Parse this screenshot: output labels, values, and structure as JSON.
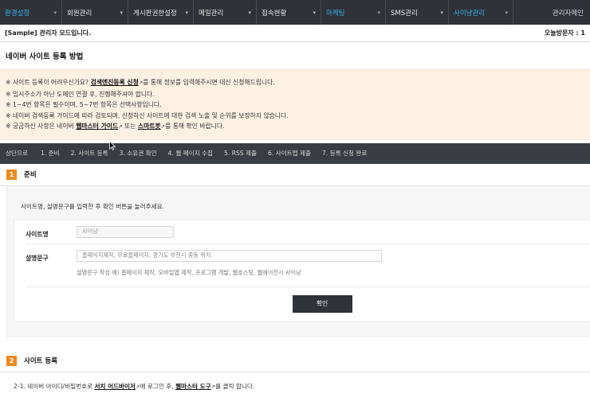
{
  "nav": {
    "items": [
      {
        "label": "환경설정",
        "active": true
      },
      {
        "label": "회원관리",
        "active": false
      },
      {
        "label": "게시판권한설정",
        "active": false
      },
      {
        "label": "메일관리",
        "active": false
      },
      {
        "label": "접속현황",
        "active": false
      },
      {
        "label": "마케팅",
        "active": true
      },
      {
        "label": "SMS관리",
        "active": false
      },
      {
        "label": "사이냥관리",
        "active": true
      }
    ],
    "admin_main": "관리자메인"
  },
  "status": {
    "mode": "[Sample] 관리자 모드입니다.",
    "visitors": "오늘방문자 : 1"
  },
  "page_title": "네이버 사이트 등록 방법",
  "notice": {
    "l1_a": "※ 사이트 등록이 어려우신가요? ",
    "l1_link": "검색엔진등록 신청",
    "l1_b": "를 통해 정보를 입력해주시면 대신 신청해드립니다.",
    "l2": "※ 임시주소가 아닌 도메인 연결 후, 진행해주셔야 합니다.",
    "l3": "※ 1~4번 항목은 필수이며, 5~7번 항목은 선택사항입니다.",
    "l4": "※ 네이버 검색등록 가이드에 따라 검토되며, 신청하신 사이트에 대한 검색 노출 및 순위를 보장하지 않습니다.",
    "l5_a": "※ 궁금하신 사항은 네이버 ",
    "l5_link1": "웹마스터 가이드",
    "l5_b": " 또는 ",
    "l5_link2": "스마트봇",
    "l5_c": "를 통해 확인 바랍니다.",
    "ext_glyph": "↗"
  },
  "steps": [
    "상단으로",
    "1. 준비",
    "2. 사이트 등록",
    "3. 소유권 확인",
    "4. 웹 페이지 수집",
    "5. RSS 제출",
    "6. 사이트맵 제출",
    "7. 등록 신청 완료"
  ],
  "section1": {
    "num": "1",
    "title": "준비",
    "desc": "사이트명, 설명문구를 입력한 후 확인 버튼을 눌러주세요.",
    "site_name_label": "사이트명",
    "site_name_value": "사이냥",
    "desc_label": "설명문구",
    "desc_value": "홈페이지제작, 무료홈페이지, 경기도 부천시 중동 위치",
    "hint": "설명문구 작성 예) 홈페이지 제작, 모바일앱 제작, 프로그램 개발, 웹호스팅, 웹에이전시 사이냥",
    "confirm": "확인"
  },
  "section2": {
    "num": "2",
    "title": "사이트 등록",
    "l_a": "2-1. 네이버 아이디/비밀번호로 ",
    "l_link1": "서치 어드바이저",
    "l_b": "에 로그인 후, ",
    "l_link2": "웹마스터 도구",
    "l_c": "를 클릭 합니다."
  }
}
